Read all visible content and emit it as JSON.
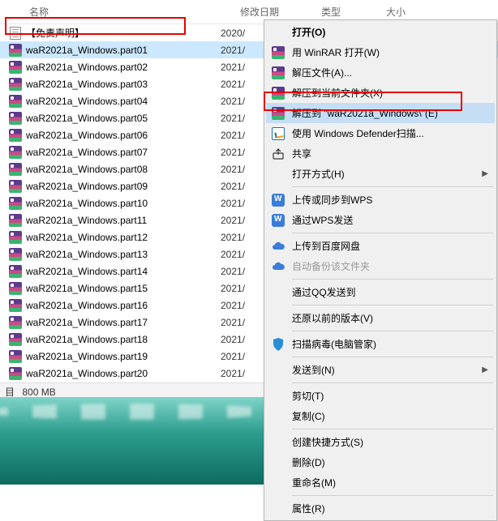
{
  "header": {
    "name": "名称",
    "date": "修改日期",
    "type": "类型",
    "size": "大小"
  },
  "files": [
    {
      "icon": "txt",
      "name": "【免责声明】",
      "date": "2020/"
    },
    {
      "icon": "rar",
      "name": "waR2021a_Windows.part01",
      "date": "2021/",
      "selected": true
    },
    {
      "icon": "rar",
      "name": "waR2021a_Windows.part02",
      "date": "2021/"
    },
    {
      "icon": "rar",
      "name": "waR2021a_Windows.part03",
      "date": "2021/"
    },
    {
      "icon": "rar",
      "name": "waR2021a_Windows.part04",
      "date": "2021/"
    },
    {
      "icon": "rar",
      "name": "waR2021a_Windows.part05",
      "date": "2021/"
    },
    {
      "icon": "rar",
      "name": "waR2021a_Windows.part06",
      "date": "2021/"
    },
    {
      "icon": "rar",
      "name": "waR2021a_Windows.part07",
      "date": "2021/"
    },
    {
      "icon": "rar",
      "name": "waR2021a_Windows.part08",
      "date": "2021/"
    },
    {
      "icon": "rar",
      "name": "waR2021a_Windows.part09",
      "date": "2021/"
    },
    {
      "icon": "rar",
      "name": "waR2021a_Windows.part10",
      "date": "2021/"
    },
    {
      "icon": "rar",
      "name": "waR2021a_Windows.part11",
      "date": "2021/"
    },
    {
      "icon": "rar",
      "name": "waR2021a_Windows.part12",
      "date": "2021/"
    },
    {
      "icon": "rar",
      "name": "waR2021a_Windows.part13",
      "date": "2021/"
    },
    {
      "icon": "rar",
      "name": "waR2021a_Windows.part14",
      "date": "2021/"
    },
    {
      "icon": "rar",
      "name": "waR2021a_Windows.part15",
      "date": "2021/"
    },
    {
      "icon": "rar",
      "name": "waR2021a_Windows.part16",
      "date": "2021/"
    },
    {
      "icon": "rar",
      "name": "waR2021a_Windows.part17",
      "date": "2021/"
    },
    {
      "icon": "rar",
      "name": "waR2021a_Windows.part18",
      "date": "2021/"
    },
    {
      "icon": "rar",
      "name": "waR2021a_Windows.part19",
      "date": "2021/"
    },
    {
      "icon": "rar",
      "name": "waR2021a_Windows.part20",
      "date": "2021/"
    }
  ],
  "status": {
    "label": "目",
    "size": "800 MB"
  },
  "menu": [
    {
      "type": "item",
      "icon": "",
      "label": "打开(O)",
      "bold": true
    },
    {
      "type": "item",
      "icon": "rar",
      "label": "用 WinRAR 打开(W)"
    },
    {
      "type": "item",
      "icon": "rar",
      "label": "解压文件(A)..."
    },
    {
      "type": "item",
      "icon": "rar",
      "label": "解压到当前文件夹(X)"
    },
    {
      "type": "item",
      "icon": "rar",
      "label": "解压到 \"waR2021a_Windows\\\"(E)",
      "hover": true
    },
    {
      "type": "item",
      "icon": "shield",
      "label": "使用 Windows Defender扫描..."
    },
    {
      "type": "item",
      "icon": "share",
      "label": "共享"
    },
    {
      "type": "item",
      "icon": "",
      "label": "打开方式(H)",
      "sub": true
    },
    {
      "type": "sep"
    },
    {
      "type": "item",
      "icon": "wps",
      "label": "上传或同步到WPS"
    },
    {
      "type": "item",
      "icon": "wps",
      "label": "通过WPS发送"
    },
    {
      "type": "sep"
    },
    {
      "type": "item",
      "icon": "cloud",
      "label": "上传到百度网盘"
    },
    {
      "type": "item",
      "icon": "cloud",
      "label": "自动备份该文件夹",
      "disabled": true
    },
    {
      "type": "sep"
    },
    {
      "type": "item",
      "icon": "",
      "label": "通过QQ发送到"
    },
    {
      "type": "sep"
    },
    {
      "type": "item",
      "icon": "",
      "label": "还原以前的版本(V)"
    },
    {
      "type": "sep"
    },
    {
      "type": "item",
      "icon": "scan",
      "label": "扫描病毒(电脑管家)"
    },
    {
      "type": "sep"
    },
    {
      "type": "item",
      "icon": "",
      "label": "发送到(N)",
      "sub": true
    },
    {
      "type": "sep"
    },
    {
      "type": "item",
      "icon": "",
      "label": "剪切(T)"
    },
    {
      "type": "item",
      "icon": "",
      "label": "复制(C)"
    },
    {
      "type": "sep"
    },
    {
      "type": "item",
      "icon": "",
      "label": "创建快捷方式(S)"
    },
    {
      "type": "item",
      "icon": "",
      "label": "删除(D)"
    },
    {
      "type": "item",
      "icon": "",
      "label": "重命名(M)"
    },
    {
      "type": "sep"
    },
    {
      "type": "item",
      "icon": "",
      "label": "属性(R)"
    }
  ]
}
